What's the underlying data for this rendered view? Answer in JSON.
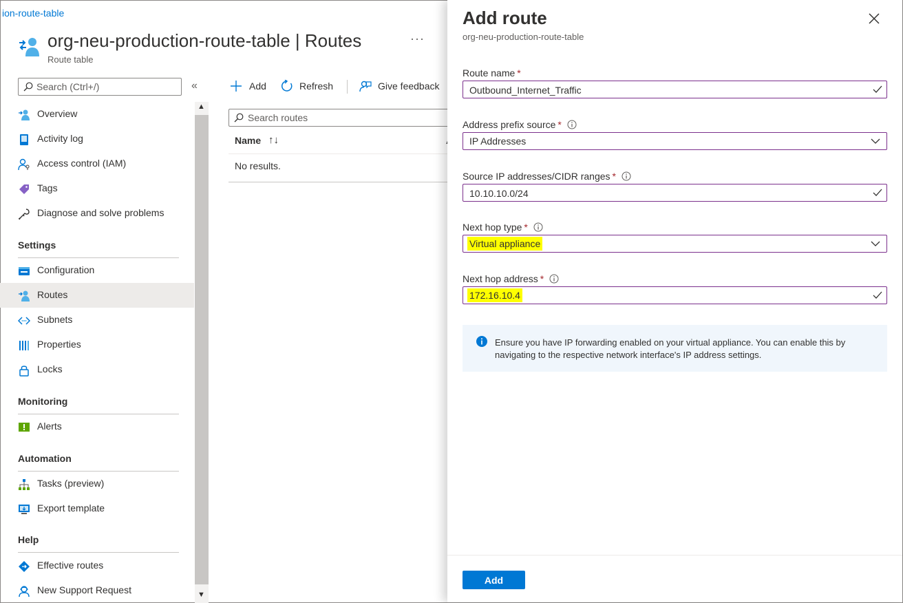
{
  "breadcrumb": "ion-route-table",
  "header": {
    "title": "org-neu-production-route-table",
    "section": "Routes",
    "separator": "|",
    "subtitle": "Route table",
    "more_label": "···",
    "icon": "route-table-icon"
  },
  "nav": {
    "search_placeholder": "Search (Ctrl+/)",
    "collapse_label": "«",
    "items": [
      {
        "label": "Overview",
        "icon": "overview-icon"
      },
      {
        "label": "Activity log",
        "icon": "activity-log-icon"
      },
      {
        "label": "Access control (IAM)",
        "icon": "iam-icon"
      },
      {
        "label": "Tags",
        "icon": "tag-icon"
      },
      {
        "label": "Diagnose and solve problems",
        "icon": "wrench-icon"
      }
    ],
    "sections": [
      {
        "title": "Settings",
        "items": [
          {
            "label": "Configuration",
            "icon": "configuration-icon"
          },
          {
            "label": "Routes",
            "icon": "routes-icon"
          },
          {
            "label": "Subnets",
            "icon": "subnets-icon"
          },
          {
            "label": "Properties",
            "icon": "properties-icon"
          },
          {
            "label": "Locks",
            "icon": "lock-icon"
          }
        ]
      },
      {
        "title": "Monitoring",
        "items": [
          {
            "label": "Alerts",
            "icon": "alerts-icon"
          }
        ]
      },
      {
        "title": "Automation",
        "items": [
          {
            "label": "Tasks (preview)",
            "icon": "tasks-icon"
          },
          {
            "label": "Export template",
            "icon": "export-template-icon"
          }
        ]
      },
      {
        "title": "Help",
        "items": [
          {
            "label": "Effective routes",
            "icon": "effective-routes-icon"
          },
          {
            "label": "New Support Request",
            "icon": "support-icon"
          }
        ]
      }
    ],
    "active": "Routes"
  },
  "toolbar": {
    "add_label": "Add",
    "refresh_label": "Refresh",
    "feedback_label": "Give feedback"
  },
  "routes": {
    "search_placeholder": "Search routes",
    "columns": [
      "Name",
      "A"
    ],
    "sort_label": "↑↓",
    "empty_text": "No results."
  },
  "panel": {
    "title": "Add route",
    "subtitle": "org-neu-production-route-table",
    "fields": {
      "route_name": {
        "label": "Route name",
        "value": "Outbound_Internet_Traffic"
      },
      "prefix_source": {
        "label": "Address prefix source",
        "value": "IP Addresses"
      },
      "source_ip": {
        "label": "Source IP addresses/CIDR ranges",
        "value": "10.10.10.0/24"
      },
      "next_hop_type": {
        "label": "Next hop type",
        "value": "Virtual appliance"
      },
      "next_hop_address": {
        "label": "Next hop address",
        "value": "172.16.10.4"
      }
    },
    "required_mark": "*",
    "info_message": "Ensure you have IP forwarding enabled on your virtual appliance. You can enable this by navigating to the respective network interface's IP address settings.",
    "submit_label": "Add"
  },
  "colors": {
    "accent": "#0078d4",
    "field_border": "#7a2f8c",
    "required": "#a4262c",
    "highlight": "#ffff00",
    "info_bg": "#f0f6fc"
  }
}
